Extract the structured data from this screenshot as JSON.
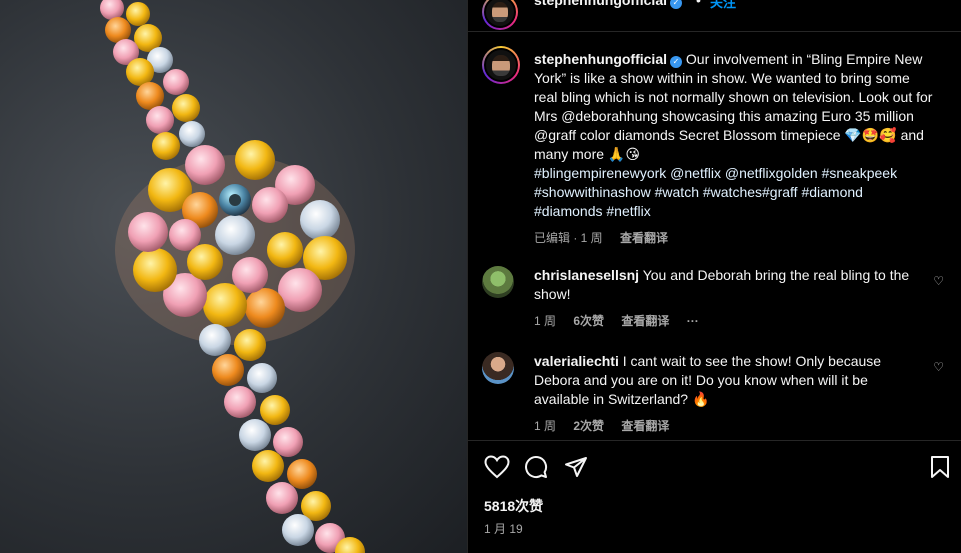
{
  "topbar": {
    "username": "stephenhungofficial",
    "dot": "•",
    "follow_label": "关注",
    "more_label": "···"
  },
  "caption": {
    "username": "stephenhungofficial",
    "text": "Our involvement in “Bling Empire New York” is like a show within in show. We wanted to bring some real bling which is not normally shown on television. Look out for Mrs @deborahhung showcasing this amazing Euro 35 million @graff color diamonds Secret Blossom timepiece 💎🤩🥰 and many more 🙏😘",
    "hashtags": "#blingempirenewyork @netflix @netflixgolden #sneakpeek #showwithinashow #watch #watches#graff #diamond #diamonds #netflix",
    "edited_label": "已编辑 · 1 周",
    "translate_label": "查看翻译"
  },
  "comments": [
    {
      "username": "chrislanesellsnj",
      "text": "You and Deborah bring the real bling to the show!",
      "time": "1 周",
      "likes": "6次赞",
      "translate": "查看翻译",
      "more": "···"
    },
    {
      "username": "valerialiechti",
      "text": "I cant wait to see the show! Only because Debora and you are on it! Do you know when will it be available in Switzerland? 🔥",
      "time": "1 周",
      "likes": "2次赞",
      "translate": "查看翻译"
    }
  ],
  "footer": {
    "likes_count": "5818次赞",
    "post_date": "1 月 19"
  },
  "colors": {
    "link": "#0095f6",
    "verified": "#3897f0",
    "muted": "#a8a8a8",
    "divider": "#262626"
  }
}
